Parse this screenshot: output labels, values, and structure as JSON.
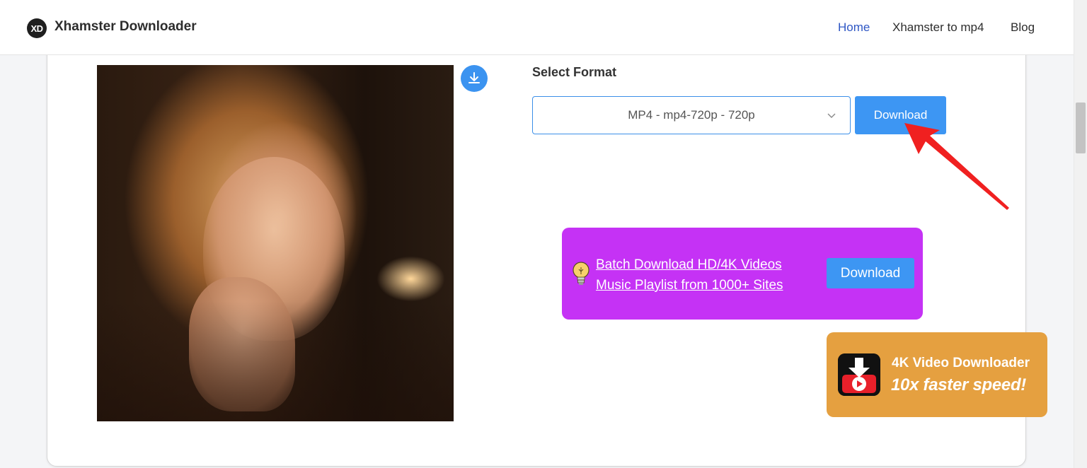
{
  "header": {
    "logo_badge": "XD",
    "site_title": "Xhamster Downloader",
    "nav": {
      "home": "Home",
      "to_mp4": "Xhamster to mp4",
      "blog": "Blog"
    }
  },
  "main": {
    "select_format_label": "Select Format",
    "format_selected": "MP4 - mp4-720p - 720p",
    "download_button": "Download"
  },
  "promo": {
    "line1": "Batch Download HD/4K Videos",
    "line2": "Music Playlist from 1000+ Sites",
    "button": "Download"
  },
  "fourk_ad": {
    "title": "4K Video Downloader",
    "subtitle": "10x faster speed!"
  },
  "colors": {
    "accent_blue": "#3d96f3",
    "nav_active": "#2f57c4",
    "promo_purple": "#c532f5",
    "ad_orange": "#e5a040",
    "arrow_red": "#f02020"
  }
}
